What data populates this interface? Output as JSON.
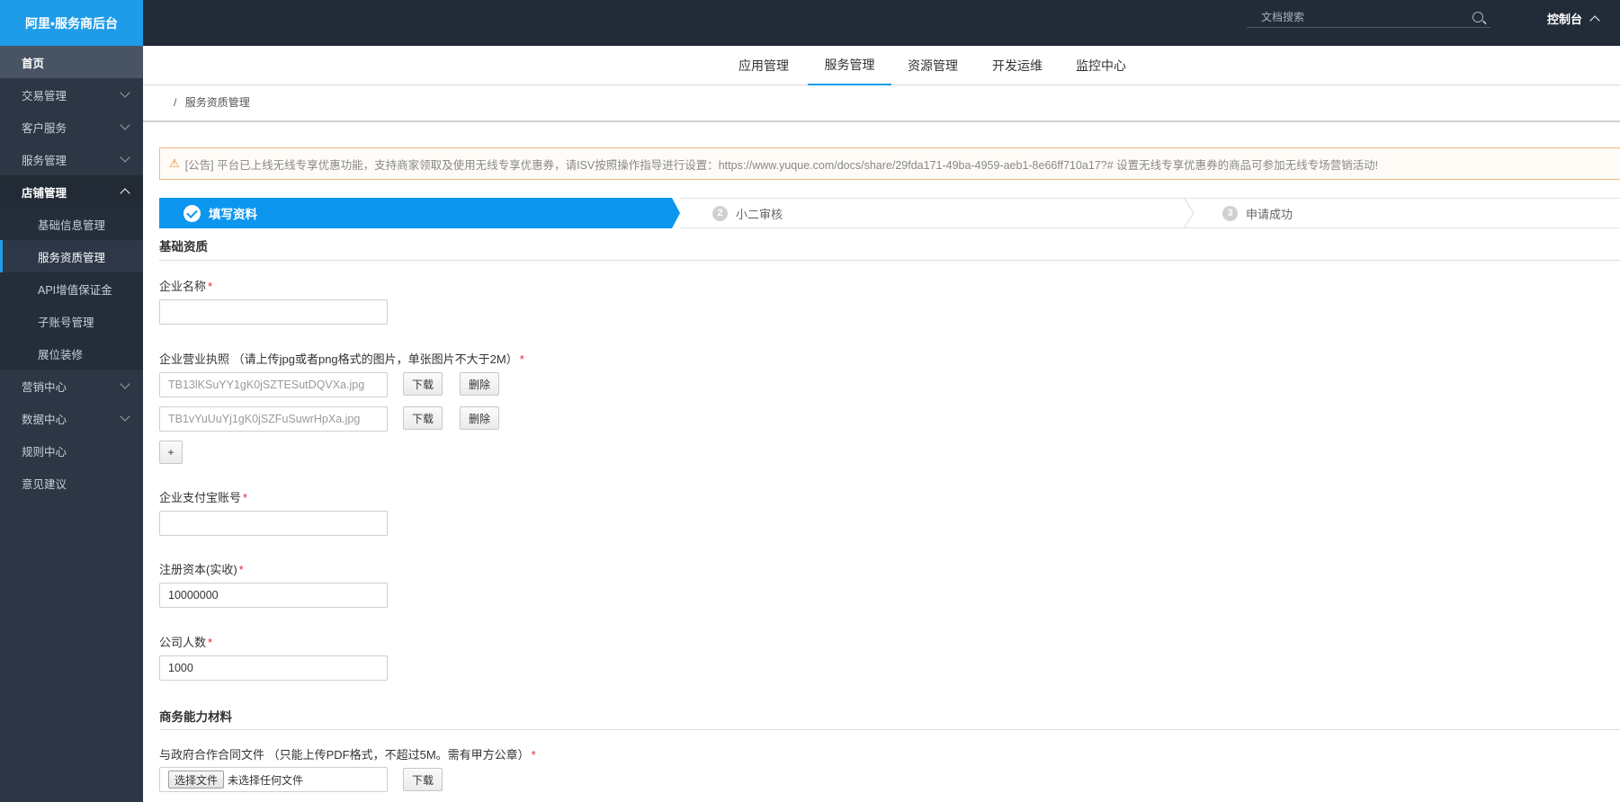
{
  "app": {
    "brand": "阿里•服务商后台"
  },
  "sidebar": {
    "items": [
      {
        "label": "首页"
      },
      {
        "label": "交易管理"
      },
      {
        "label": "客户服务"
      },
      {
        "label": "服务管理"
      },
      {
        "label": "店铺管理"
      },
      {
        "label": "基础信息管理"
      },
      {
        "label": "服务资质管理"
      },
      {
        "label": "API增值保证金"
      },
      {
        "label": "子账号管理"
      },
      {
        "label": "展位装修"
      },
      {
        "label": "营销中心"
      },
      {
        "label": "数据中心"
      },
      {
        "label": "规则中心"
      },
      {
        "label": "意见建议"
      }
    ]
  },
  "topbar": {
    "search_placeholder": "文档搜索",
    "console_label": "控制台"
  },
  "tabs": [
    {
      "label": "应用管理"
    },
    {
      "label": "服务管理",
      "active": true
    },
    {
      "label": "资源管理"
    },
    {
      "label": "开发运维"
    },
    {
      "label": "监控中心"
    }
  ],
  "breadcrumb": {
    "separator": "/",
    "current": "服务资质管理"
  },
  "notice": {
    "icon": "warning-icon",
    "text": "[公告] 平台已上线无线专享优惠功能，支持商家领取及使用无线专享优惠券，请ISV按照操作指导进行设置：https://www.yuque.com/docs/share/29fda171-49ba-4959-aeb1-8e66ff710a17?# 设置无线专享优惠券的商品可参加无线专场营销活动!"
  },
  "steps": [
    {
      "number": "1",
      "label": "填写资料",
      "status": "active"
    },
    {
      "number": "2",
      "label": "小二审核",
      "status": "pending"
    },
    {
      "number": "3",
      "label": "申请成功",
      "status": "pending"
    }
  ],
  "form": {
    "section_basic": "基础资质",
    "company_name": {
      "label": "企业名称",
      "required_mark": "*",
      "value": ""
    },
    "business_license": {
      "label": "企业营业执照 （请上传jpg或者png格式的图片，单张图片不大于2M）",
      "required_mark": "*",
      "files": [
        {
          "name": "TB13lKSuYY1gK0jSZTESutDQVXa.jpg",
          "download_label": "下载",
          "delete_label": "删除"
        },
        {
          "name": "TB1vYuUuYj1gK0jSZFuSuwrHpXa.jpg",
          "download_label": "下载",
          "delete_label": "删除"
        }
      ],
      "add_label": "+"
    },
    "alipay_account": {
      "label": "企业支付宝账号",
      "required_mark": "*",
      "value": ""
    },
    "registered_capital": {
      "label": "注册资本(实收)",
      "required_mark": "*",
      "value": "10000000"
    },
    "employee_count": {
      "label": "公司人数",
      "required_mark": "*",
      "value": "1000"
    },
    "section_business": "商务能力材料",
    "gov_contract": {
      "label": "与政府合作合同文件 （只能上传PDF格式，不超过5M。需有甲方公章）",
      "required_mark": "*",
      "choose_label": "选择文件",
      "no_file_text": "未选择任何文件",
      "download_label": "下载"
    }
  }
}
